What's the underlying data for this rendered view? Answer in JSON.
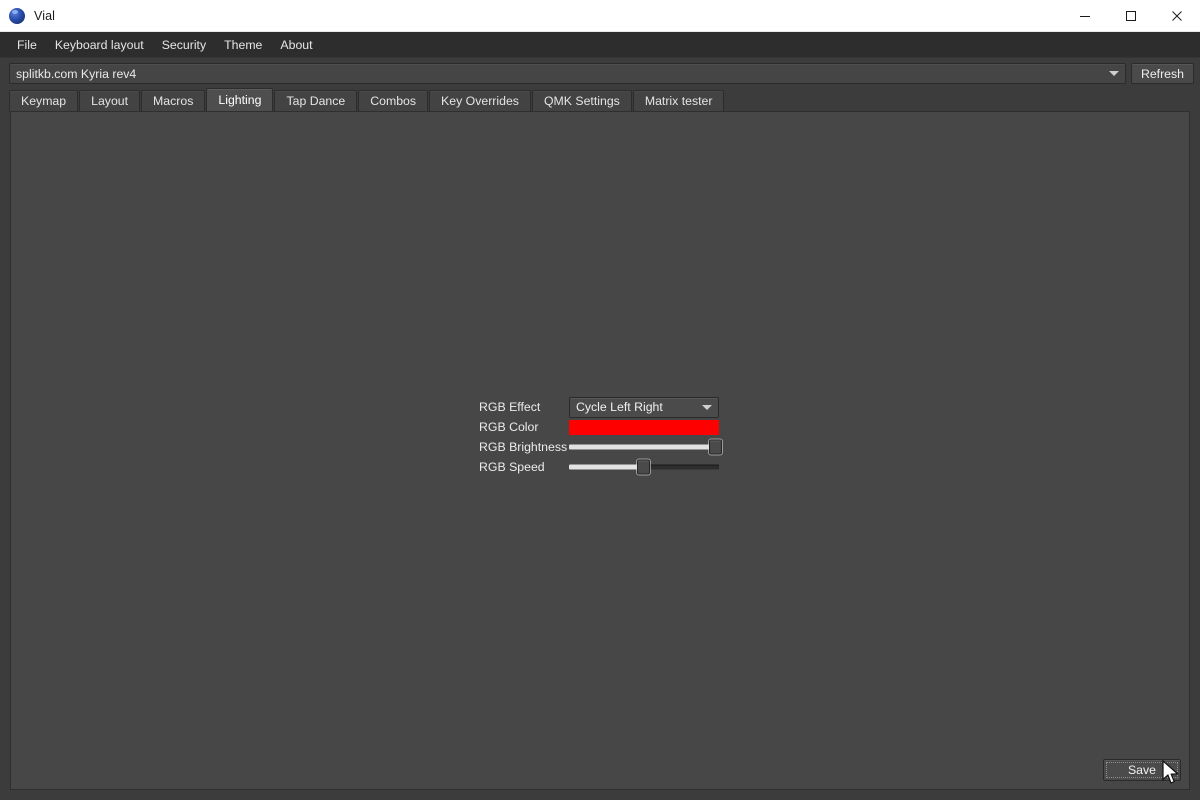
{
  "window": {
    "title": "Vial",
    "icon": "vial-app-icon",
    "controls": [
      {
        "name": "minimize",
        "glyph": "minimize-icon"
      },
      {
        "name": "maximize",
        "glyph": "maximize-icon"
      },
      {
        "name": "close",
        "glyph": "close-icon"
      }
    ]
  },
  "menubar": {
    "items": [
      {
        "label": "File"
      },
      {
        "label": "Keyboard layout"
      },
      {
        "label": "Security"
      },
      {
        "label": "Theme"
      },
      {
        "label": "About"
      }
    ]
  },
  "device": {
    "selected": "splitkb.com Kyria rev4",
    "refresh_label": "Refresh",
    "dropdown_icon": "chevron-down-icon"
  },
  "tabs": {
    "items": [
      {
        "label": "Keymap",
        "active": false
      },
      {
        "label": "Layout",
        "active": false
      },
      {
        "label": "Macros",
        "active": false
      },
      {
        "label": "Lighting",
        "active": true
      },
      {
        "label": "Tap Dance",
        "active": false
      },
      {
        "label": "Combos",
        "active": false
      },
      {
        "label": "Key Overrides",
        "active": false
      },
      {
        "label": "QMK Settings",
        "active": false
      },
      {
        "label": "Matrix tester",
        "active": false
      }
    ]
  },
  "lighting": {
    "effect": {
      "label": "RGB Effect",
      "value": "Cycle Left Right",
      "dropdown_icon": "chevron-down-icon"
    },
    "color": {
      "label": "RGB Color",
      "value": "#FF0000"
    },
    "brightness": {
      "label": "RGB Brightness",
      "percent": 97
    },
    "speed": {
      "label": "RGB Speed",
      "percent": 49
    }
  },
  "footer": {
    "save_label": "Save"
  },
  "theme": {
    "window_bg": "#3c3c3c",
    "panel_bg": "#474747",
    "menubar_bg": "#2d2d2d",
    "titlebar_bg": "#ffffff",
    "text": "#ececec",
    "accent_red": "#FF0000",
    "active_tab_bg": "#4e4e4e"
  }
}
